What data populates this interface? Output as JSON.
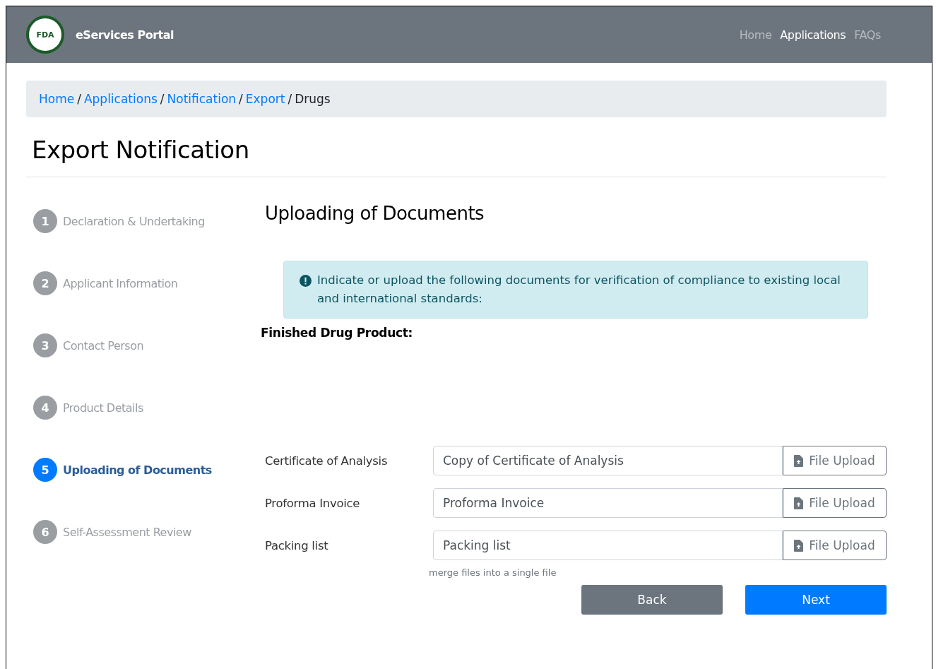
{
  "header": {
    "logo_text": "FDA",
    "brand": "eServices Portal",
    "nav": [
      {
        "label": "Home",
        "selected": false
      },
      {
        "label": "Applications",
        "selected": true
      },
      {
        "label": "FAQs",
        "selected": false
      }
    ]
  },
  "breadcrumb": {
    "separator": "/",
    "items": [
      {
        "label": "Home",
        "link": true
      },
      {
        "label": "Applications",
        "link": true
      },
      {
        "label": "Notification",
        "link": true
      },
      {
        "label": "Export",
        "link": true
      },
      {
        "label": "Drugs",
        "link": false
      }
    ]
  },
  "page_title": "Export Notification",
  "steps": [
    {
      "number": "1",
      "label": "Declaration & Undertaking",
      "selected": false
    },
    {
      "number": "2",
      "label": "Applicant Information",
      "selected": false
    },
    {
      "number": "3",
      "label": "Contact Person",
      "selected": false
    },
    {
      "number": "4",
      "label": "Product Details",
      "selected": false
    },
    {
      "number": "5",
      "label": "Uploading of Documents",
      "selected": true
    },
    {
      "number": "6",
      "label": "Self-Assessment Review",
      "selected": false
    }
  ],
  "section_title": "Uploading of Documents",
  "alert": "Indicate or upload the following documents for verification of compliance to existing local and international standards:",
  "subheading": "Finished Drug Product:",
  "documents": [
    {
      "label": "Certificate of Analysis",
      "value": "Copy of Certificate of Analysis",
      "button": "File Upload"
    },
    {
      "label": "Proforma Invoice",
      "value": "Proforma Invoice",
      "button": "File Upload"
    },
    {
      "label": "Packing list",
      "value": "Packing list",
      "button": "File Upload"
    }
  ],
  "hint": "merge files into a single file",
  "buttons": [
    {
      "kind": "secondary",
      "label": "Back"
    },
    {
      "kind": "primary",
      "label": "Next"
    }
  ]
}
